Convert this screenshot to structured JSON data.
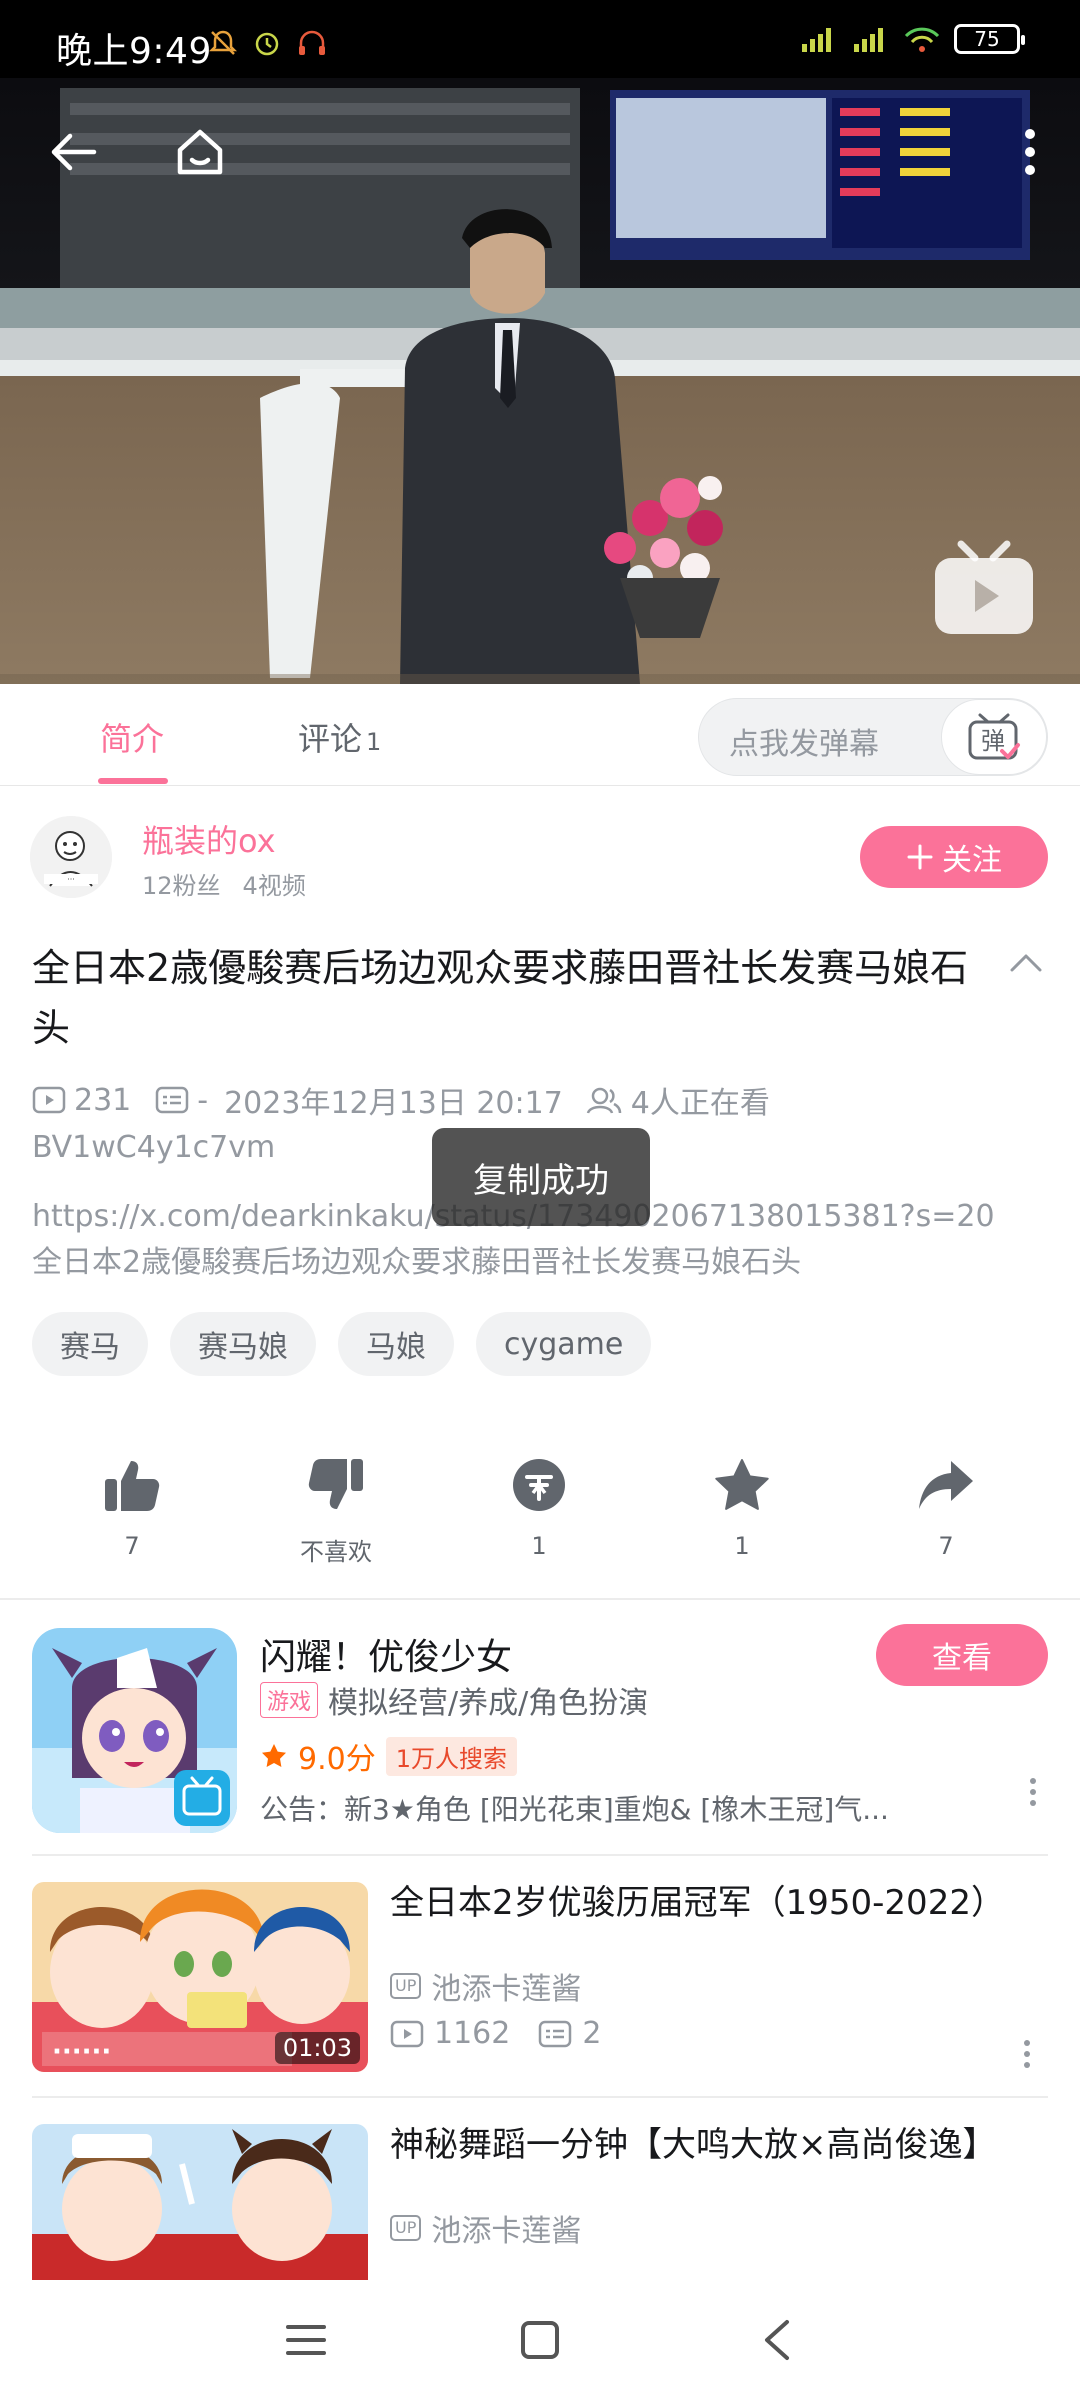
{
  "status_bar": {
    "time": "晚上9:49",
    "battery": "75"
  },
  "video": {
    "controls": {
      "back": "back-arrow-icon",
      "home": "home-icon",
      "more": "more-vertical-icon",
      "danmaku_play": "bilibili-tv-icon"
    }
  },
  "tabs": {
    "intro_label": "简介",
    "comments_label": "评论",
    "comments_count": "1",
    "danmaku_placeholder": "点我发弹幕",
    "danmaku_icon_text": "弹"
  },
  "uploader": {
    "name": "瓶装的ox",
    "fans": "12粉丝",
    "videos": "4视频",
    "follow_label": "关注"
  },
  "video_info": {
    "title": "全日本2歳優駿赛后场边观众要求藤田晋社长发赛马娘石头",
    "views": "231",
    "danmaku": "-",
    "datetime": "2023年12月13日 20:17",
    "watching": "4人正在看",
    "bvid": "BV1wC4y1c7vm",
    "desc_line1": "https://x.com/dearkinkaku/status/1734902067138015381?s=20",
    "desc_line2": "全日本2歳優駿赛后场边观众要求藤田晋社长发赛马娘石头",
    "toast": "复制成功"
  },
  "tags": [
    "赛马",
    "赛马娘",
    "马娘",
    "cygame"
  ],
  "actions": {
    "like": "7",
    "dislike": "不喜欢",
    "coin": "1",
    "favorite": "1",
    "share": "7"
  },
  "game_card": {
    "title": "闪耀！优俊少女",
    "badge": "游戏",
    "genre": "模拟经营/养成/角色扮演",
    "rating": "9.0分",
    "search_badge": "1万人搜索",
    "notice": "公告：新3★角色 [阳光花束]重炮& [橡木王冠]气...",
    "button": "查看"
  },
  "related": [
    {
      "title": "全日本2岁优骏历届冠军（1950-2022）",
      "author": "池添卡莲酱",
      "views": "1162",
      "danmaku": "2",
      "duration": "01:03"
    },
    {
      "title": "神秘舞蹈一分钟【大鸣大放×高尚俊逸】",
      "author": "池添卡莲酱"
    }
  ],
  "colors": {
    "accent": "#fb7299",
    "rating": "#ff6a00",
    "muted": "#9499a0"
  }
}
